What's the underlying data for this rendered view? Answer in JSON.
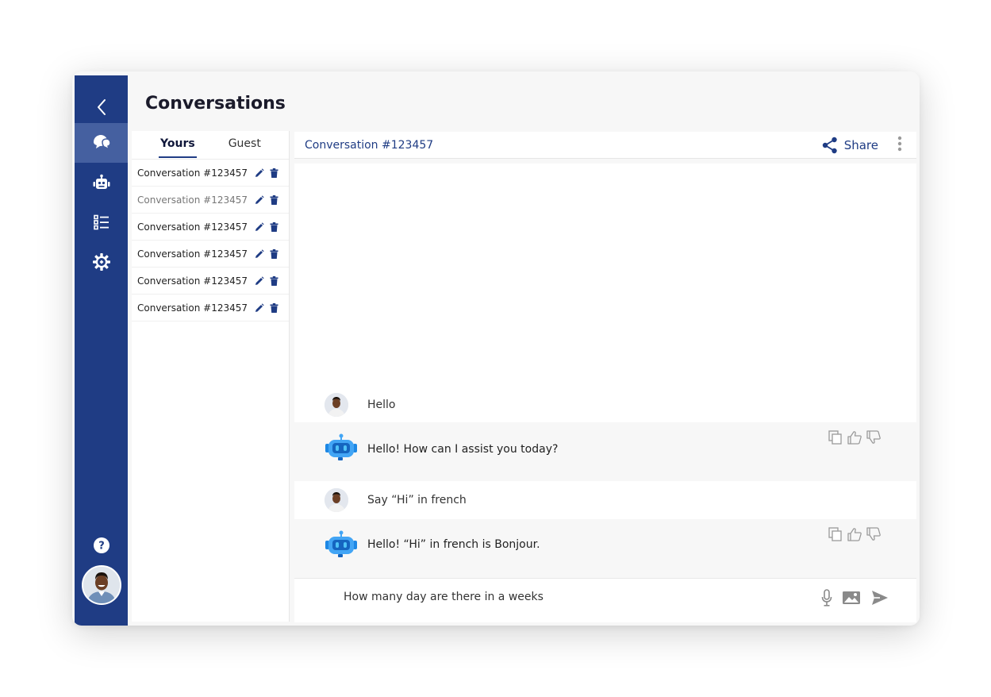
{
  "page": {
    "title": "Conversations"
  },
  "rail": {
    "items": [
      {
        "name": "back",
        "icon": "chevron-left-icon"
      },
      {
        "name": "conversations",
        "icon": "chat-bubbles-icon",
        "active": true
      },
      {
        "name": "bots",
        "icon": "robot-icon"
      },
      {
        "name": "list",
        "icon": "list-icon"
      },
      {
        "name": "settings",
        "icon": "gear-icon"
      }
    ],
    "help_icon": "help-circle-icon",
    "avatar": "user-avatar"
  },
  "tabs": [
    {
      "label": "Yours",
      "active": true
    },
    {
      "label": "Guest",
      "active": false
    }
  ],
  "conversations": [
    {
      "label": "Conversation #123457",
      "muted": false
    },
    {
      "label": "Conversation #123457",
      "muted": true
    },
    {
      "label": "Conversation #123457",
      "muted": false
    },
    {
      "label": "Conversation #123457",
      "muted": false
    },
    {
      "label": "Conversation #123457",
      "muted": false
    },
    {
      "label": "Conversation #123457",
      "muted": false
    }
  ],
  "chat": {
    "title": "Conversation #123457",
    "share_label": "Share",
    "messages": [
      {
        "role": "user",
        "text": "Hello"
      },
      {
        "role": "bot",
        "text": "Hello! How can I assist you today?"
      },
      {
        "role": "user",
        "text": "Say “Hi” in french"
      },
      {
        "role": "bot",
        "text": "Hello!  “Hi” in french is Bonjour."
      }
    ],
    "composer_value": "How many day are there in a weeks "
  },
  "colors": {
    "brand": "#1f3c84",
    "rail_active": "#4560a0",
    "bot_blue": "#2196f3"
  }
}
